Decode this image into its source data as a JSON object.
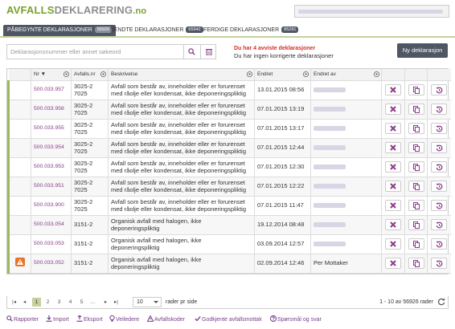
{
  "header": {
    "logo_part1": "AVFALLS",
    "logo_part2": "DEKLARERING",
    "logo_part3": ".no"
  },
  "tabs": [
    {
      "label": "PÅBEGYNTE DEKLARASJONER",
      "badge": "56926",
      "active": true
    },
    {
      "label": "SENDTE DEKLARASJONER",
      "badge": "65942",
      "active": false
    },
    {
      "label": "FERDIGE DEKLARASJONER",
      "badge": "85281",
      "active": false
    }
  ],
  "search": {
    "placeholder": "Deklarasjonsnummer eller annet søkeord"
  },
  "warnings": {
    "line1": "Du har 4 avviste deklarasjoner",
    "line2": "Du har ingen korrigerte deklarasjoner"
  },
  "new_button": "Ny deklarasjon",
  "grid": {
    "columns": [
      "Nr",
      "Avfalls.nr",
      "Beskrivelse",
      "Endret",
      "Endret av"
    ],
    "sort_indicator": "▼",
    "rows": [
      {
        "nr": "500.033.957",
        "avfallsnr": "3025-2 7025",
        "beskrivelse": "Avfall som består av, inneholder eller er forurenset med råolje eller kondensat, ikke deponeringspliktig",
        "endret": "13.01.2015 08:56",
        "endret_av": "",
        "warn": false
      },
      {
        "nr": "500.033.956",
        "avfallsnr": "3025-2 7025",
        "beskrivelse": "Avfall som består av, inneholder eller er forurenset med råolje eller kondensat, ikke deponeringspliktig",
        "endret": "07.01.2015 13:19",
        "endret_av": "",
        "warn": false
      },
      {
        "nr": "500.033.955",
        "avfallsnr": "3025-2 7025",
        "beskrivelse": "Avfall som består av, inneholder eller er forurenset med råolje eller kondensat, ikke deponeringspliktig",
        "endret": "07.01.2015 13:17",
        "endret_av": "",
        "warn": false
      },
      {
        "nr": "500.033.954",
        "avfallsnr": "3025-2 7025",
        "beskrivelse": "Avfall som består av, inneholder eller er forurenset med råolje eller kondensat, ikke deponeringspliktig",
        "endret": "07.01.2015 12:44",
        "endret_av": "",
        "warn": false
      },
      {
        "nr": "500.033.953",
        "avfallsnr": "3025-2 7025",
        "beskrivelse": "Avfall som består av, inneholder eller er forurenset med råolje eller kondensat, ikke deponeringspliktig",
        "endret": "07.01.2015 12:30",
        "endret_av": "",
        "warn": false
      },
      {
        "nr": "500.033.951",
        "avfallsnr": "3025-2 7025",
        "beskrivelse": "Avfall som består av, inneholder eller er forurenset med råolje eller kondensat, ikke deponeringspliktig",
        "endret": "07.01.2015 12:22",
        "endret_av": "",
        "warn": false
      },
      {
        "nr": "500.033.900",
        "avfallsnr": "3025-2 7025",
        "beskrivelse": "Avfall som består av, inneholder eller er forurenset med råolje eller kondensat, ikke deponeringspliktig",
        "endret": "07.01.2015 11:47",
        "endret_av": "",
        "warn": false
      },
      {
        "nr": "500.033.054",
        "avfallsnr": "3151-2",
        "beskrivelse": "Organisk avfall med halogen, ikke deponeringspliktig",
        "endret": "19.12.2014 08:48",
        "endret_av": "",
        "warn": false
      },
      {
        "nr": "500.033.053",
        "avfallsnr": "3151-2",
        "beskrivelse": "Organisk avfall med halogen, ikke deponeringspliktig",
        "endret": "03.09.2014 12:57",
        "endret_av": "",
        "warn": false
      },
      {
        "nr": "500.033.052",
        "avfallsnr": "3151-2",
        "beskrivelse": "Organisk avfall med halogen, ikke deponeringspliktig",
        "endret": "02.09.2014 12:46",
        "endret_av": "Per Mottaker",
        "warn": true
      }
    ]
  },
  "pager": {
    "pages": [
      "1",
      "2",
      "3",
      "4",
      "5",
      "..."
    ],
    "current_page": "1",
    "page_size": "10",
    "page_size_label": "rader pr side",
    "info": "1 - 10 av 56926 rader"
  },
  "footer": [
    {
      "label": "Rapporter",
      "icon": "search-icon"
    },
    {
      "label": "Import",
      "icon": "import-icon"
    },
    {
      "label": "Eksport",
      "icon": "export-icon"
    },
    {
      "label": "Veiledere",
      "icon": "lightbulb-icon"
    },
    {
      "label": "Avfallskoder",
      "icon": "warning-icon"
    },
    {
      "label": "Godkjente avfallsmottak",
      "icon": "check-icon"
    },
    {
      "label": "Spørsmål og svar",
      "icon": "question-icon"
    }
  ],
  "colors": {
    "brand_green": "#7aa12a",
    "dark_button": "#4f5664",
    "link_purple": "#8a3c8a",
    "warning_red": "#d72d2d",
    "warning_orange": "#e8732a"
  }
}
